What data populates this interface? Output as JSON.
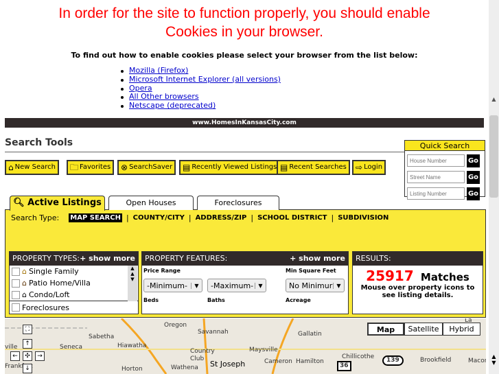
{
  "warning": {
    "line1": "In order for the site to function properly, you should enable",
    "line2": "Cookies in your browser.",
    "sub": "To find out how to enable cookies please select your browser from the list below:"
  },
  "browsers": [
    "Mozilla (Firefox)",
    "Microsoft Internet Explorer (all versions)",
    "Opera",
    "All Other browsers",
    "Netscape (deprecated)"
  ],
  "site_bar": "www.HomesInKansasCity.com",
  "search_tools": {
    "title": "Search Tools",
    "buttons": [
      "New Search",
      "Favorites",
      "SearchSaver",
      "Recently Viewed Listings",
      "Recent Searches",
      "Login"
    ]
  },
  "quick_search": {
    "title": "Quick Search",
    "fields": [
      "House Number",
      "Street Name",
      "Listing Number"
    ],
    "go": "Go"
  },
  "tabs": [
    "Active Listings",
    "Open Houses",
    "Foreclosures"
  ],
  "search_type": {
    "label": "Search Type:",
    "options": [
      "MAP SEARCH",
      "COUNTY/CITY",
      "ADDRESS/ZIP",
      "SCHOOL DISTRICT",
      "SUBDIVISION"
    ],
    "selected": "MAP SEARCH"
  },
  "property_types": {
    "title": "PROPERTY TYPES:",
    "more": "+ show more",
    "items": [
      "Single Family",
      "Patio Home/Villa",
      "Condo/Loft"
    ],
    "foreclosures": "Foreclosures"
  },
  "property_features": {
    "title": "PROPERTY FEATURES:",
    "more": "+ show more",
    "price_range": "Price Range",
    "min": "-Minimum-",
    "max": "-Maximum-",
    "min_sqft": "Min Square Feet",
    "sqft_value": "No Minimur",
    "beds": "Beds",
    "baths": "Baths",
    "acreage": "Acreage"
  },
  "results": {
    "title": "RESULTS:",
    "count": "25917",
    "matches": "Matches",
    "hint": "Mouse over property icons to see listing details."
  },
  "map": {
    "types": [
      "Map",
      "Satellite",
      "Hybrid"
    ],
    "selected": "Map",
    "labels": [
      "Oregon",
      "Savannah",
      "Sabetha",
      "Hiawatha",
      "Gallatin",
      "Seneca",
      "Maysville",
      "Country Club",
      "Chillicothe",
      "St Joseph",
      "Cameron",
      "Hamilton",
      "Brookfield",
      "Macon",
      "Wathena",
      "Horton",
      "La Plata",
      "ville",
      "Frankfort"
    ],
    "shields": [
      "139",
      "36"
    ]
  },
  "colors": {
    "accent": "#fae51e",
    "dark": "#312a2a",
    "warning": "#ff0000",
    "count": "#ff0000"
  }
}
